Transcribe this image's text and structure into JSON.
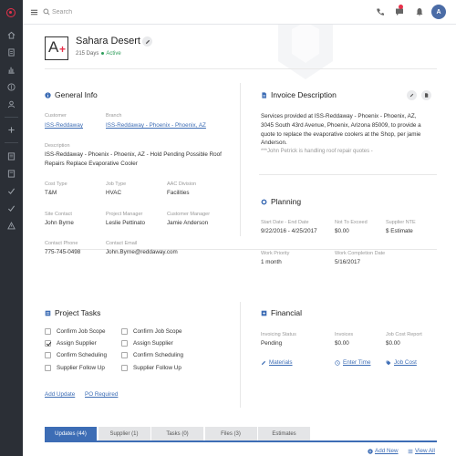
{
  "topbar": {
    "search_placeholder": "Search",
    "avatar_initial": "A"
  },
  "header": {
    "title": "Sahara Desert",
    "days": "215 Days",
    "status": "Active"
  },
  "general": {
    "title": "General Info",
    "fields": {
      "customer": {
        "label": "Customer",
        "value": "ISS-Reddaway"
      },
      "branch": {
        "label": "Branch",
        "value": "ISS-Reddaway - Phoenix - Phoenix, AZ"
      },
      "description": {
        "label": "Description",
        "value": "ISS-Reddaway - Phoenix - Phoenix, AZ - Hold Pending Possible Roof Repairs Replace Evaporative Cooler"
      },
      "cost_type": {
        "label": "Cost Type",
        "value": "T&M"
      },
      "job_type": {
        "label": "Job Type",
        "value": "HVAC"
      },
      "aac_division": {
        "label": "AAC Division",
        "value": "Facilities"
      },
      "site_contact": {
        "label": "Site Contact",
        "value": "John Byrne"
      },
      "project_manager": {
        "label": "Project Manager",
        "value": "Leslie Pettinato"
      },
      "customer_manager": {
        "label": "Customer Manager",
        "value": "Jamie Anderson"
      },
      "contact_phone": {
        "label": "Contact Phone",
        "value": "775-745-0498"
      },
      "contact_email": {
        "label": "Contact Email",
        "value": "John.Byrne@reddaway.com"
      }
    }
  },
  "invoice": {
    "title": "Invoice Description",
    "text": "Services provided at ISS-Reddaway - Phoenix - Phoenix, AZ, 3045 South 43rd Avenue, Phoenix, Arizona 85009, to provide a quote to replace the evaporative coolers at the Shop, per jamie Anderson.",
    "note": "***John Petrick is handling roof repair quotes -"
  },
  "planning": {
    "title": "Planning",
    "fields": {
      "dates": {
        "label": "Start Date - End Date",
        "value": "9/22/2016 - 4/25/2017"
      },
      "not_to_exceed": {
        "label": "Not To Exceed",
        "value": "$0.00"
      },
      "supplier_nte": {
        "label": "Supplier NTE",
        "value": "$ Estimate"
      },
      "work_priority": {
        "label": "Work Priority",
        "value": "1 month"
      },
      "work_completion": {
        "label": "Work Completion Date",
        "value": "5/16/2017"
      }
    }
  },
  "tasks": {
    "title": "Project Tasks",
    "left": [
      {
        "label": "Confirm Job Scope",
        "checked": false
      },
      {
        "label": "Assign Supplier",
        "checked": true
      },
      {
        "label": "Confirm Scheduling",
        "checked": false
      },
      {
        "label": "Supplier Follow Up",
        "checked": false
      }
    ],
    "right": [
      {
        "label": "Confirm Job Scope",
        "checked": false
      },
      {
        "label": "Assign Supplier",
        "checked": false
      },
      {
        "label": "Confirm Scheduling",
        "checked": false
      },
      {
        "label": "Supplier Follow Up",
        "checked": false
      }
    ],
    "add_update": "Add Update",
    "po_required": "PO Required"
  },
  "financial": {
    "title": "Financial",
    "fields": {
      "invoicing_status": {
        "label": "Invoicing Status",
        "value": "Pending"
      },
      "invoices": {
        "label": "Invoices",
        "value": "$0.00"
      },
      "job_cost_report": {
        "label": "Job Cost Report",
        "value": "$0.00"
      }
    },
    "links": {
      "materials": "Materials",
      "time": "Enter Time",
      "job_cost": "Job Cost"
    }
  },
  "tabs": [
    "Updates (44)",
    "Supplier (1)",
    "Tasks (0)",
    "Files (3)",
    "Estimates"
  ],
  "bottom": {
    "add_new": "Add New",
    "view_all": "View All"
  },
  "colors": {
    "accent": "#3d6db5",
    "brand": "#e8304a",
    "active": "#2f9e5b",
    "sidebar": "#2b2f36"
  }
}
